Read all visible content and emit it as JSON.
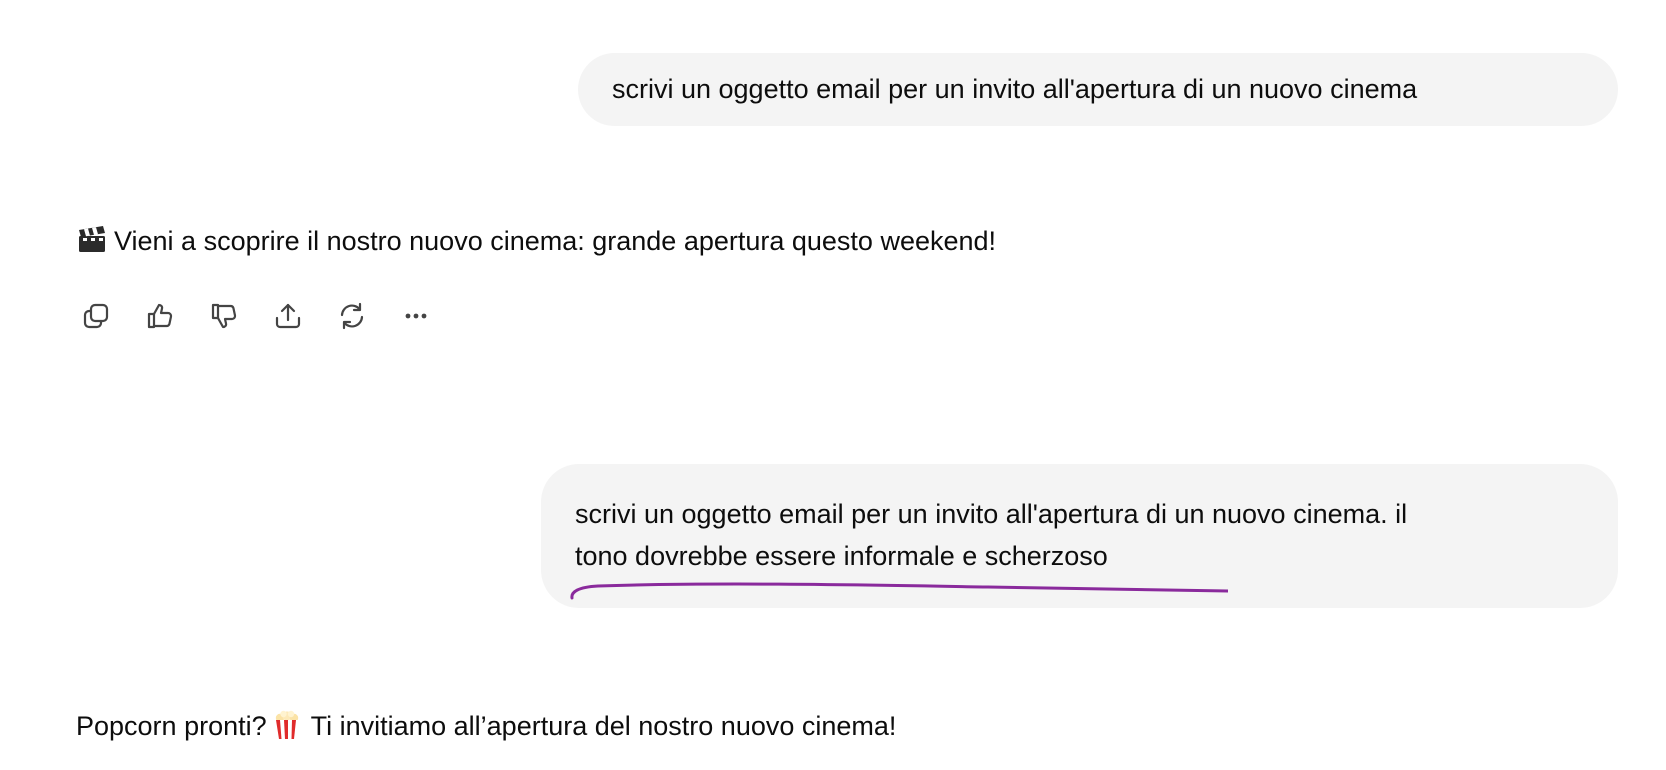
{
  "conversation": {
    "messages": [
      {
        "role": "user",
        "text": "scrivi un oggetto email per un invito all'apertura di un nuovo cinema"
      },
      {
        "role": "assistant",
        "emoji": "clapper-board-icon",
        "text": "Vieni a scoprire il nostro nuovo cinema: grande apertura questo weekend!"
      },
      {
        "role": "user",
        "line1": "scrivi un oggetto email per un invito all'apertura di un nuovo cinema. il",
        "line2": "tono dovrebbe essere informale e scherzoso",
        "highlight_color": "#8a2a9c"
      },
      {
        "role": "assistant",
        "text_before": "Popcorn pronti?",
        "emoji": "popcorn-icon",
        "text_after": "Ti invitiamo all’apertura del nostro nuovo cinema!"
      }
    ]
  },
  "actions": [
    {
      "name": "copy",
      "icon": "copy-icon"
    },
    {
      "name": "good-response",
      "icon": "thumbs-up-icon"
    },
    {
      "name": "bad-response",
      "icon": "thumbs-down-icon"
    },
    {
      "name": "share",
      "icon": "share-icon"
    },
    {
      "name": "regenerate",
      "icon": "regenerate-icon"
    },
    {
      "name": "more",
      "icon": "more-icon"
    }
  ],
  "colors": {
    "user_bubble": "#f4f4f4",
    "text": "#0d0d0d",
    "icon": "#5d5d5d",
    "annotation": "#8a2a9c"
  }
}
